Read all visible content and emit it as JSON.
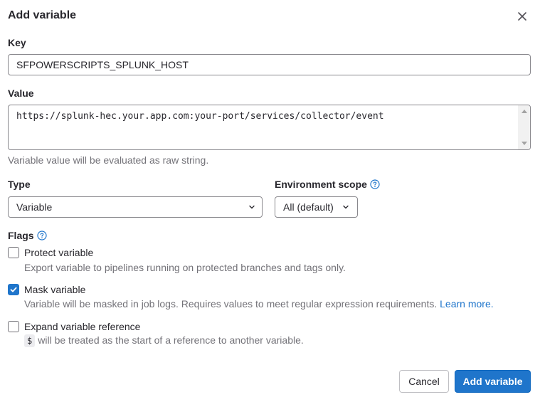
{
  "modal": {
    "title": "Add variable",
    "close_label": "×"
  },
  "key": {
    "label": "Key",
    "value": "SFPOWERSCRIPTS_SPLUNK_HOST"
  },
  "value": {
    "label": "Value",
    "text": "https://splunk-hec.your.app.com:your-port/services/collector/event",
    "help": "Variable value will be evaluated as raw string."
  },
  "type": {
    "label": "Type",
    "selected": "Variable"
  },
  "environment": {
    "label": "Environment scope",
    "selected": "All (default)"
  },
  "flags": {
    "label": "Flags",
    "items": [
      {
        "label": "Protect variable",
        "help": "Export variable to pipelines running on protected branches and tags only.",
        "checked": false
      },
      {
        "label": "Mask variable",
        "help": "Variable will be masked in job logs. Requires values to meet regular expression requirements.",
        "link": "Learn more.",
        "checked": true
      },
      {
        "label": "Expand variable reference",
        "code": "$",
        "help": "will be treated as the start of a reference to another variable.",
        "checked": false
      }
    ]
  },
  "buttons": {
    "cancel": "Cancel",
    "add": "Add variable"
  },
  "colors": {
    "primary": "#1f75cb",
    "text": "#28272d",
    "muted": "#737278"
  },
  "icons": [
    "close-icon",
    "chevron-down-icon",
    "question-circle-icon",
    "check-icon"
  ]
}
